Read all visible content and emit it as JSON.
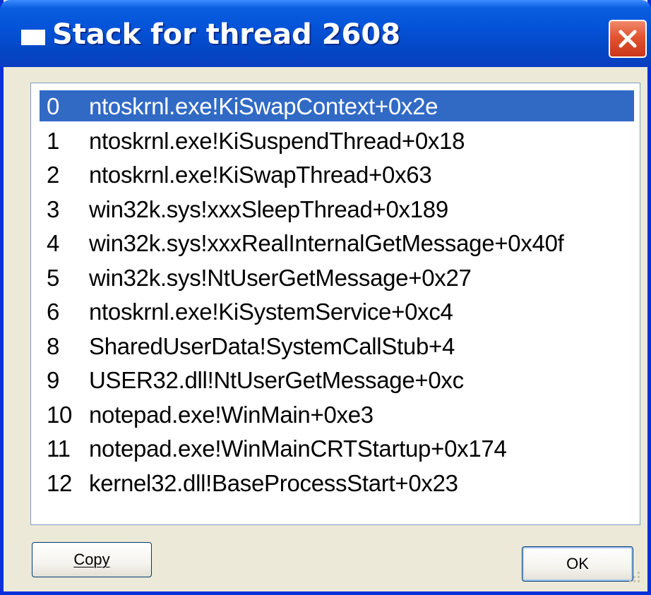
{
  "window": {
    "title": "Stack for thread 2608"
  },
  "stack": [
    {
      "index": "0",
      "frame": "ntoskrnl.exe!KiSwapContext+0x2e",
      "selected": true
    },
    {
      "index": "1",
      "frame": "ntoskrnl.exe!KiSuspendThread+0x18"
    },
    {
      "index": "2",
      "frame": "ntoskrnl.exe!KiSwapThread+0x63"
    },
    {
      "index": "3",
      "frame": "win32k.sys!xxxSleepThread+0x189"
    },
    {
      "index": "4",
      "frame": "win32k.sys!xxxRealInternalGetMessage+0x40f"
    },
    {
      "index": "5",
      "frame": "win32k.sys!NtUserGetMessage+0x27"
    },
    {
      "index": "6",
      "frame": "ntoskrnl.exe!KiSystemService+0xc4"
    },
    {
      "index": "8",
      "frame": "SharedUserData!SystemCallStub+4"
    },
    {
      "index": "9",
      "frame": "USER32.dll!NtUserGetMessage+0xc"
    },
    {
      "index": "10",
      "frame": "notepad.exe!WinMain+0xe3"
    },
    {
      "index": "11",
      "frame": "notepad.exe!WinMainCRTStartup+0x174"
    },
    {
      "index": "12",
      "frame": "kernel32.dll!BaseProcessStart+0x23"
    }
  ],
  "buttons": {
    "copy_label": "Copy",
    "ok_label": "OK"
  },
  "colors": {
    "titlebar": "#0453d8",
    "selection": "#316ac5",
    "close": "#e0542f",
    "dialog_bg": "#ece9d8"
  }
}
